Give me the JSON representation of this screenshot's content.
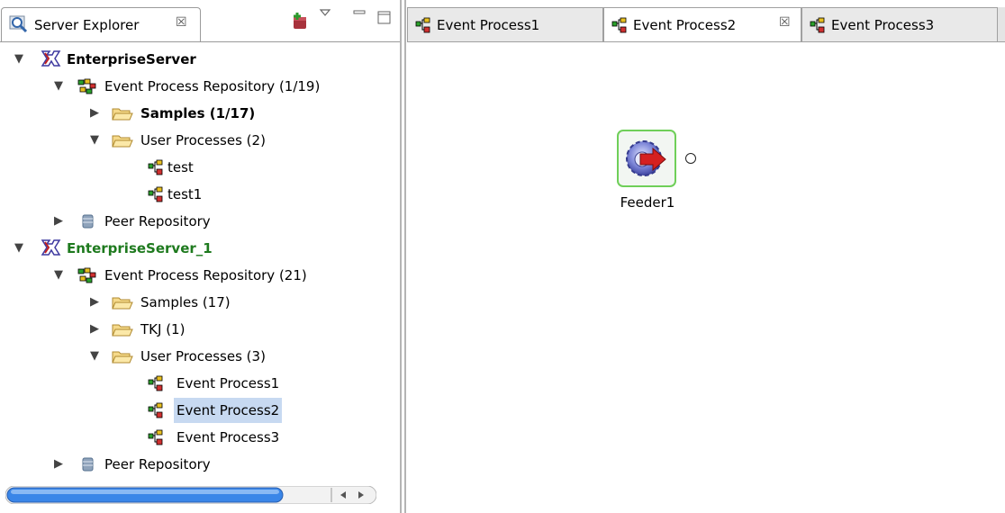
{
  "server_explorer": {
    "tab_title": "Server Explorer",
    "close_glyph": "☒",
    "toolbar_icons": [
      "new-connection-icon",
      "view-menu-icon",
      "minimize-icon",
      "maximize-icon"
    ]
  },
  "tree": [
    {
      "label": "EnterpriseServer",
      "icon": "server-icon",
      "expanded": true,
      "style": "bold"
    },
    {
      "label": "Event Process Repository (1/19)",
      "icon": "repository-icon",
      "expanded": true
    },
    {
      "label": "Samples (1/17)",
      "icon": "folder-icon",
      "expanded": false,
      "style": "bold"
    },
    {
      "label": "User Processes (2)",
      "icon": "folder-icon",
      "expanded": true
    },
    {
      "label": "test",
      "icon": "event-process-icon"
    },
    {
      "label": "test1",
      "icon": "event-process-icon"
    },
    {
      "label": "Peer Repository",
      "icon": "database-icon",
      "expanded": false
    },
    {
      "label": "EnterpriseServer_1",
      "icon": "server-icon",
      "expanded": true,
      "style": "bold-green"
    },
    {
      "label": "Event Process Repository (21)",
      "icon": "repository-icon",
      "expanded": true
    },
    {
      "label": "Samples (17)",
      "icon": "folder-icon",
      "expanded": false
    },
    {
      "label": "TKJ (1)",
      "icon": "folder-icon",
      "expanded": false
    },
    {
      "label": "User Processes (3)",
      "icon": "folder-icon",
      "expanded": true
    },
    {
      "label": "Event Process1",
      "icon": "event-process-icon"
    },
    {
      "label": "Event Process2",
      "icon": "event-process-icon",
      "selected": true
    },
    {
      "label": "Event Process3",
      "icon": "event-process-icon"
    },
    {
      "label": "Peer Repository",
      "icon": "database-icon",
      "expanded": false
    }
  ],
  "editor": {
    "tabs": [
      {
        "label": "Event Process1",
        "active": false
      },
      {
        "label": "Event Process2",
        "active": true
      },
      {
        "label": "Event Process3",
        "active": false
      }
    ],
    "close_glyph": "☒",
    "node": {
      "label": "Feeder1",
      "icon": "feeder-gear-icon",
      "port": "output-port"
    }
  },
  "colors": {
    "selection": "#c7d9f1",
    "server_green": "#1e7a1e",
    "node_border": "#6fcf59",
    "scroll_thumb": "#3a86e8"
  }
}
